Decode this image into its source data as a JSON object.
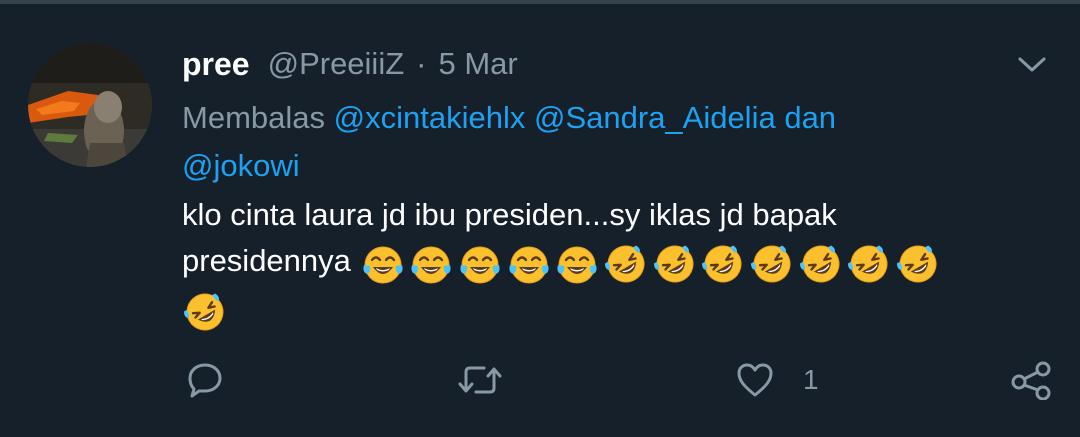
{
  "tweet": {
    "author": {
      "display_name": "pree",
      "handle": "@PreeiiiZ"
    },
    "separator": "·",
    "date": "5 Mar",
    "reply": {
      "prefix": "Membalas",
      "mention_1": "@xcintakiehlx",
      "mention_2": "@Sandra_Aidelia",
      "conjunction": "dan",
      "mention_3": "@jokowi"
    },
    "text_line_1": "klo cinta laura jd ibu presiden...sy iklas jd bapak",
    "text_line_2": "presidennya",
    "emojis": [
      "face-with-tears-of-joy",
      "face-with-tears-of-joy",
      "face-with-tears-of-joy",
      "face-with-tears-of-joy",
      "face-with-tears-of-joy",
      "rolling-on-the-floor-laughing",
      "rolling-on-the-floor-laughing",
      "rolling-on-the-floor-laughing",
      "rolling-on-the-floor-laughing",
      "rolling-on-the-floor-laughing",
      "rolling-on-the-floor-laughing",
      "rolling-on-the-floor-laughing",
      "rolling-on-the-floor-laughing"
    ],
    "actions": {
      "reply_icon": "reply-icon",
      "retweet_icon": "retweet-icon",
      "like_icon": "heart-icon",
      "like_count": "1",
      "share_icon": "share-icon"
    }
  },
  "colors": {
    "background": "#15202b",
    "divider": "#38444d",
    "secondary_text": "#8899a6",
    "link": "#1da1f2",
    "primary_text": "#ffffff"
  }
}
